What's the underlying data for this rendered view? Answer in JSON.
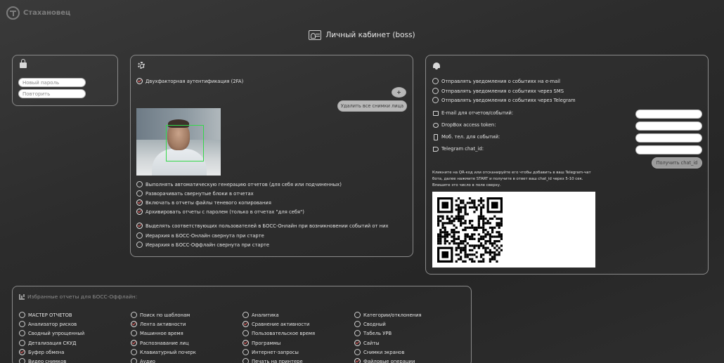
{
  "app": {
    "logo_text": "Стахановец"
  },
  "header": {
    "title": "Личный кабинет (boss)"
  },
  "password_panel": {
    "new_password_placeholder": "Новый пароль",
    "repeat_placeholder": "Повторить"
  },
  "settings_panel": {
    "twofa": {
      "label": "Двухфакторная аутентификация (2FA)",
      "checked": true
    },
    "add_button": "+",
    "delete_face_button": "Удалить все снимки лица",
    "options": [
      {
        "label": "Выполнять автоматическую генерацию отчетов (для себя или подчиненных)",
        "checked": false
      },
      {
        "label": "Разворачивать свернутые блоки в отчетах",
        "checked": false
      },
      {
        "label": "Включать в отчеты файлы теневого копирования",
        "checked": true
      },
      {
        "label": "Архивировать отчеты с паролем (только в отчетах \"для себя\")",
        "checked": true
      },
      {
        "label": "Выделять соответствующих пользователей в БОСС-Онлайн при возникновении событий от них",
        "checked": true
      },
      {
        "label": "Иерархия в БОСС-Онлайн свернута при старте",
        "checked": false
      },
      {
        "label": "Иерархия в БОСС-Оффлайн свернута при старте",
        "checked": false
      }
    ]
  },
  "notify_panel": {
    "options": [
      {
        "label": "Отправлять уведомления о событиях на e-mail",
        "checked": false
      },
      {
        "label": "Отправлять уведомления о событиях через SMS",
        "checked": false
      },
      {
        "label": "Отправлять уведомления о событиях через Telegram",
        "checked": false
      }
    ],
    "fields": [
      {
        "label": "E-mail для отчетов/событий:",
        "icon": "envelope-icon",
        "value": ""
      },
      {
        "label": "DropBox access token:",
        "icon": "dropbox-icon",
        "value": ""
      },
      {
        "label": "Моб. тел. для событий:",
        "icon": "phone-icon",
        "value": ""
      },
      {
        "label": "Telegram chat_id:",
        "icon": "telegram-icon",
        "value": ""
      }
    ],
    "get_chat_id_button": "Получить chat_id",
    "instructions": "Кликните на QR-код или отсканируйте его чтобы добавить в ваш Telegram-чат бота, далее нажмите START и получите в ответ ваш chat_id через 5-10 сек. Впишите это число в поле сверху."
  },
  "favorites_panel": {
    "title": "Избранные отчеты для БОСС-Оффлайн:",
    "columns": [
      [
        {
          "label": "МАСТЕР ОТЧЕТОВ",
          "checked": false
        },
        {
          "label": "Анализатор рисков",
          "checked": false
        },
        {
          "label": "Сводный упрощенный",
          "checked": false
        },
        {
          "label": "Детализация СКУД",
          "checked": false
        },
        {
          "label": "Буфер обмена",
          "checked": true
        },
        {
          "label": "Видео снимков",
          "checked": false
        }
      ],
      [
        {
          "label": "Поиск по шаблонам",
          "checked": false
        },
        {
          "label": "Лента активности",
          "checked": true
        },
        {
          "label": "Машинное время",
          "checked": false
        },
        {
          "label": "Распознавание лиц",
          "checked": true
        },
        {
          "label": "Клавиатурный почерк",
          "checked": false
        },
        {
          "label": "Аудио",
          "checked": false
        }
      ],
      [
        {
          "label": "Аналитика",
          "checked": false
        },
        {
          "label": "Сравнение активности",
          "checked": true
        },
        {
          "label": "Пользовательское время",
          "checked": false
        },
        {
          "label": "Программы",
          "checked": true
        },
        {
          "label": "Интернет-запросы",
          "checked": false
        },
        {
          "label": "Печать на принтере",
          "checked": false
        }
      ],
      [
        {
          "label": "Категории/отклонения",
          "checked": false
        },
        {
          "label": "Сводный",
          "checked": false
        },
        {
          "label": "Табель УРВ",
          "checked": false
        },
        {
          "label": "Сайты",
          "checked": true
        },
        {
          "label": "Снимки экранов",
          "checked": false
        },
        {
          "label": "Файловые операции",
          "checked": true
        }
      ]
    ]
  }
}
